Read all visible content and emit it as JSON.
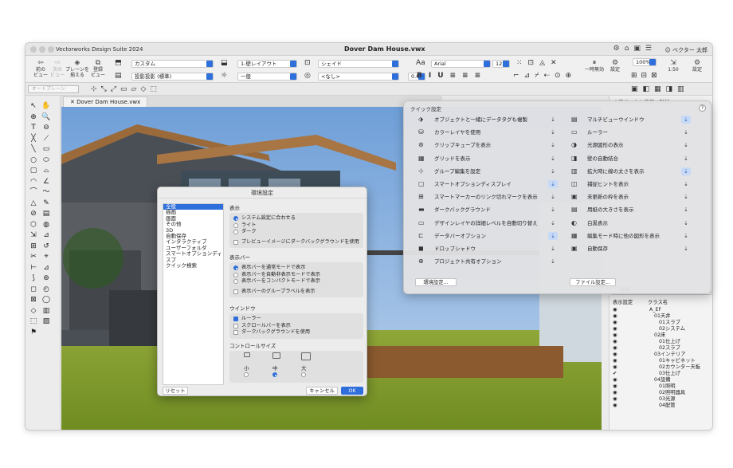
{
  "app_title": "Vectorworks Design Suite 2024",
  "doc_title": "Dover Dam House.vwx",
  "user": "ベクター 太郎",
  "toolbar": {
    "prev_view": "前の\nビュー",
    "next_view": "次の\nビュー",
    "align_plane": "プレーンを\n揃える",
    "register_view": "登録\nビュー",
    "custom": "カスタム",
    "layout": "1-壁レイアウト",
    "shade": "シェイド",
    "font": "Arial",
    "size": "12",
    "projection": "投影投影 (標準)",
    "general": "一般",
    "none": "<なし>",
    "angle": "0.00°",
    "disable": "一時無効",
    "settings": "設定",
    "zoom": "100%",
    "scale": "1:50",
    "settings2": "設定"
  },
  "modebar": {
    "auto": "オートプレーン"
  },
  "tab": "Dover Dam House.vwx",
  "dialog": {
    "title": "環境設定",
    "categories": [
      "全般",
      "描画",
      "画面",
      "その他",
      "3D",
      "自動保存",
      "インタラクティブ",
      "ユーザーフォルダ",
      "スマートオプションディスプ",
      "クイック検索"
    ],
    "display_h": "表示",
    "display_opts": [
      "システム設定に合わせる",
      "ライト",
      "ダーク"
    ],
    "preview_dark": "プレビューイメージにダークバックグラウンドを使用",
    "viewbar_h": "表示バー",
    "viewbar_opts": [
      "表示バーを通常モードで表示",
      "表示バーを自動非表示モードで表示",
      "表示バーをコンパクトモードで表示"
    ],
    "viewbar_group": "表示バーのグループラベルを表示",
    "window_h": "ウインドウ",
    "window_opts": [
      "ルーラー",
      "スクロールバーを表示",
      "ダークバックグラウンドを使用"
    ],
    "ctrl_h": "コントロールサイズ",
    "sizes": [
      "小",
      "中",
      "大"
    ],
    "reset": "リセット",
    "cancel": "キャンセル",
    "ok": "OK"
  },
  "quick": {
    "header": "クイック設定",
    "left": [
      "オブジェクトと一緒にデータタグも複製",
      "カラーレイヤを使用",
      "クリップキューブを表示",
      "グリッドを表示",
      "グループ編集を設定",
      "スマートオプションディスプレイ",
      "スマートマーカーのリンク切れマークを表示",
      "ダークバックグラウンド",
      "デザインレイヤの詳細レベルを自動切り替え",
      "データバーオプション",
      "ドロップシャドウ",
      "プロジェクト共有オプション"
    ],
    "right": [
      "マルチビューウインドウ",
      "ルーラー",
      "光源図形の表示",
      "壁の自動結合",
      "拡大時に線の太さを表示",
      "捕捉ヒントを表示",
      "未更新の枠を表示",
      "用紙の大きさを表示",
      "白黒表示",
      "編集モード時に他の図形を表示",
      "自動保存"
    ],
    "prefs": "環境設定...",
    "file": "ファイル設定..."
  },
  "panel": {
    "title": "オブジェクト情報 - 形状",
    "search": "検索",
    "col1": "表示設定",
    "col2": "クラス名",
    "classes": [
      "A_EF",
      "01天井",
      "01スラブ",
      "02システム",
      "02床",
      "01仕上げ",
      "02スラブ",
      "03インテリア",
      "01キャビネット",
      "02カウンター天板",
      "03仕上げ",
      "04設備",
      "01照明",
      "02照明器具",
      "03光源",
      "04配管"
    ]
  }
}
